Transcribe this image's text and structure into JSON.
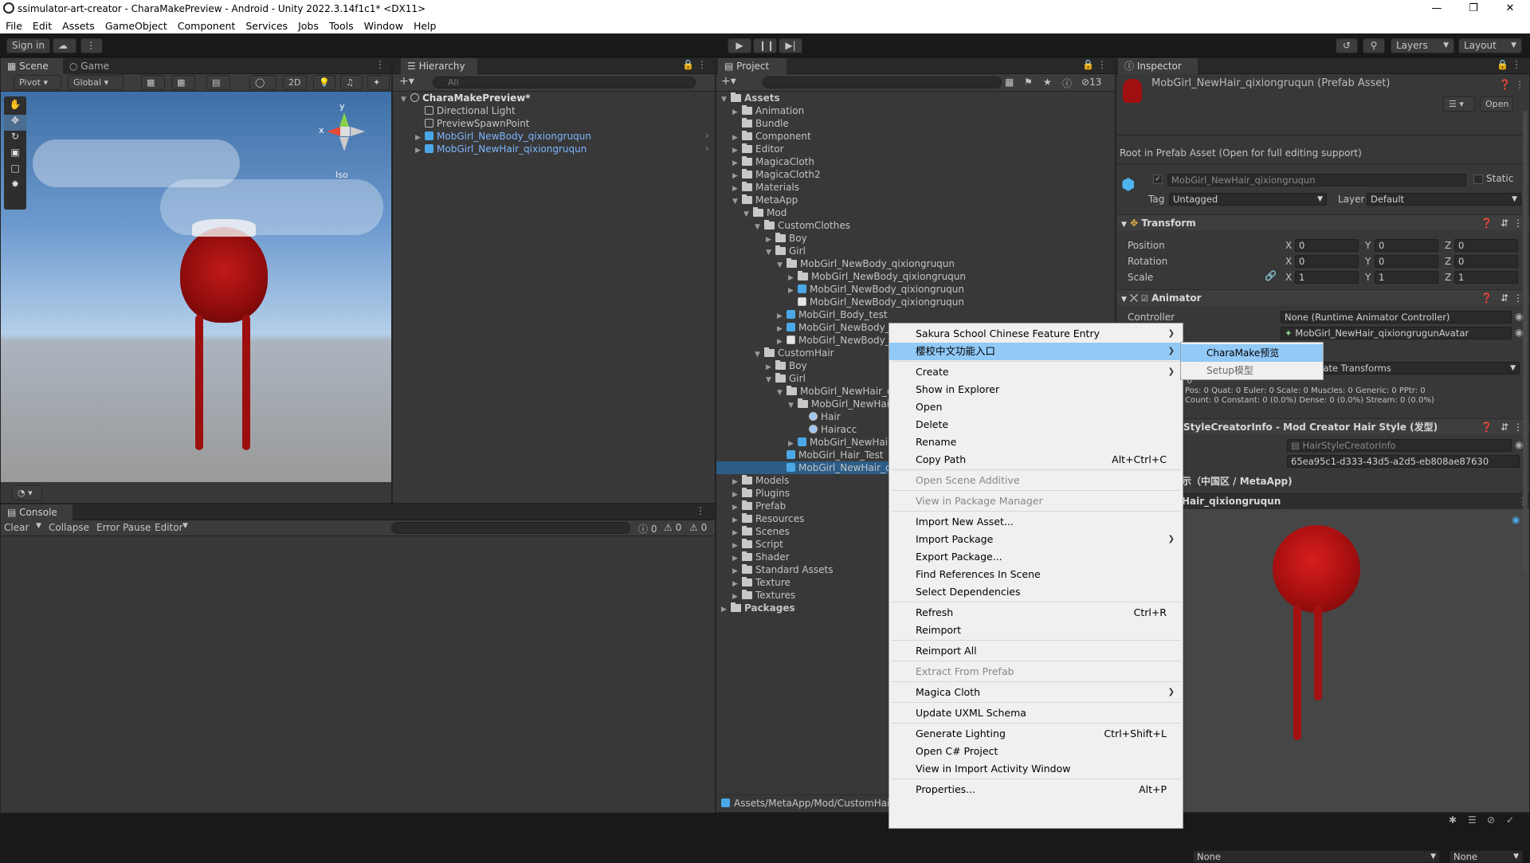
{
  "window": {
    "title": "ssimulator-art-creator - CharaMakePreview - Android - Unity 2022.3.14f1c1* <DX11>"
  },
  "menu": [
    "File",
    "Edit",
    "Assets",
    "GameObject",
    "Component",
    "Services",
    "Jobs",
    "Tools",
    "Window",
    "Help"
  ],
  "toolbar": {
    "sign_in": "Sign in",
    "layers": "Layers",
    "layout": "Layout"
  },
  "scene": {
    "tab_scene": "Scene",
    "tab_game": "Game",
    "pivot": "Pivot",
    "global": "Global",
    "mode_2d": "2D",
    "iso": "Iso",
    "axis_x": "x",
    "axis_y": "y"
  },
  "hierarchy": {
    "tab": "Hierarchy",
    "search": "All",
    "root": "CharaMakePreview*",
    "items": [
      "Directional Light",
      "PreviewSpawnPoint",
      "MobGirl_NewBody_qixiongruqun",
      "MobGirl_NewHair_qixiongruqun"
    ]
  },
  "project": {
    "tab": "Project",
    "count": "13",
    "path": "Assets/MetaApp/Mod/CustomHair/",
    "tree": [
      {
        "label": "Assets",
        "depth": 0,
        "type": "folder",
        "open": true
      },
      {
        "label": "Animation",
        "depth": 1,
        "type": "folder"
      },
      {
        "label": "Bundle",
        "depth": 1,
        "type": "folder",
        "noarrow": true
      },
      {
        "label": "Component",
        "depth": 1,
        "type": "folder"
      },
      {
        "label": "Editor",
        "depth": 1,
        "type": "folder"
      },
      {
        "label": "MagicaCloth",
        "depth": 1,
        "type": "folder"
      },
      {
        "label": "MagicaCloth2",
        "depth": 1,
        "type": "folder"
      },
      {
        "label": "Materials",
        "depth": 1,
        "type": "folder"
      },
      {
        "label": "MetaApp",
        "depth": 1,
        "type": "folder",
        "open": true
      },
      {
        "label": "Mod",
        "depth": 2,
        "type": "folder",
        "open": true
      },
      {
        "label": "CustomClothes",
        "depth": 3,
        "type": "folder",
        "open": true
      },
      {
        "label": "Boy",
        "depth": 4,
        "type": "folder"
      },
      {
        "label": "Girl",
        "depth": 4,
        "type": "folder",
        "open": true
      },
      {
        "label": "MobGirl_NewBody_qixiongruqun",
        "depth": 5,
        "type": "folder",
        "open": true
      },
      {
        "label": "MobGirl_NewBody_qixiongruqun",
        "depth": 6,
        "type": "folder"
      },
      {
        "label": "MobGirl_NewBody_qixiongruqun",
        "depth": 6,
        "type": "prefab"
      },
      {
        "label": "MobGirl_NewBody_qixiongruqun",
        "depth": 6,
        "type": "image",
        "noarrow": true
      },
      {
        "label": "MobGirl_Body_test",
        "depth": 5,
        "type": "cube"
      },
      {
        "label": "MobGirl_NewBody_qixiongruqun",
        "depth": 5,
        "type": "cube"
      },
      {
        "label": "MobGirl_NewBody_qixiongruqun",
        "depth": 5,
        "type": "image"
      },
      {
        "label": "CustomHair",
        "depth": 3,
        "type": "folder",
        "open": true
      },
      {
        "label": "Boy",
        "depth": 4,
        "type": "folder"
      },
      {
        "label": "Girl",
        "depth": 4,
        "type": "folder",
        "open": true
      },
      {
        "label": "MobGirl_NewHair_qixiongruqun",
        "depth": 5,
        "type": "folder",
        "open": true
      },
      {
        "label": "MobGirl_NewHair_qixiongruqun",
        "depth": 6,
        "type": "folder",
        "open": true
      },
      {
        "label": "Hair",
        "depth": 7,
        "type": "sphere",
        "noarrow": true
      },
      {
        "label": "Hairacc",
        "depth": 7,
        "type": "sphere",
        "noarrow": true
      },
      {
        "label": "MobGirl_NewHair_qixiongruqun",
        "depth": 6,
        "type": "prefab"
      },
      {
        "label": "MobGirl_Hair_Test",
        "depth": 5,
        "type": "cube",
        "noarrow": true
      },
      {
        "label": "MobGirl_NewHair_qixiongruqun",
        "depth": 5,
        "type": "cube",
        "noarrow": true,
        "selected": true
      },
      {
        "label": "Models",
        "depth": 1,
        "type": "folder"
      },
      {
        "label": "Plugins",
        "depth": 1,
        "type": "folder"
      },
      {
        "label": "Prefab",
        "depth": 1,
        "type": "folder"
      },
      {
        "label": "Resources",
        "depth": 1,
        "type": "folder"
      },
      {
        "label": "Scenes",
        "depth": 1,
        "type": "folder"
      },
      {
        "label": "Script",
        "depth": 1,
        "type": "folder"
      },
      {
        "label": "Shader",
        "depth": 1,
        "type": "folder"
      },
      {
        "label": "Standard Assets",
        "depth": 1,
        "type": "folder"
      },
      {
        "label": "Texture",
        "depth": 1,
        "type": "folder"
      },
      {
        "label": "Textures",
        "depth": 1,
        "type": "folder"
      },
      {
        "label": "Packages",
        "depth": 0,
        "type": "folder"
      }
    ]
  },
  "console": {
    "tab": "Console",
    "clear": "Clear",
    "collapse": "Collapse",
    "error_pause": "Error Pause",
    "editor": "Editor",
    "c1": "0",
    "c2": "0",
    "c3": "0"
  },
  "inspector": {
    "tab": "Inspector",
    "asset_title": "MobGirl_NewHair_qixiongruqun (Prefab Asset)",
    "open": "Open",
    "root_note": "Root in Prefab Asset (Open for full editing support)",
    "name": "MobGirl_NewHair_qixiongruqun",
    "static": "Static",
    "tag_label": "Tag",
    "tag": "Untagged",
    "layer_label": "Layer",
    "layer": "Default",
    "transform": "Transform",
    "position": "Position",
    "rotation": "Rotation",
    "scale": "Scale",
    "px": "0",
    "py": "0",
    "pz": "0",
    "rx": "0",
    "ry": "0",
    "rz": "0",
    "sx": "1",
    "sy": "1",
    "sz": "1",
    "X": "X",
    "Y": "Y",
    "Z": "Z",
    "animator": "Animator",
    "controller_label": "Controller",
    "controller": "None (Runtime Animator Controller)",
    "avatar": "MobGirl_NewHair_qixiongrugunAvatar",
    "culling": "Cull Update Transforms",
    "stats1": "Pos: 0 Quat: 0 Euler: 0 Scale: 0 Muscles: 0 Generic: 0 PPtr: 0",
    "stats2": "Count: 0 Constant: 0 (0.0%) Dense: 0 (0.0%) Stream: 0 (0.0%)",
    "stats0": ": 0",
    "hairstyle_head": "StyleCreatorInfo - Mod Creator Hair Style (发型)",
    "hairstyle_field": "HairStyleCreatorInfo",
    "guid": "65ea95c1-d333-43d5-a2d5-eb808ae87630",
    "display": "示（中国区 / MetaApp)",
    "preview_name": "Hair_qixiongruqun",
    "none1": "None",
    "none2": "None"
  },
  "context_menu": {
    "items": [
      {
        "label": "Sakura School Chinese Feature Entry",
        "sub": true
      },
      {
        "label": "樱校中文功能入口",
        "sub": true,
        "hl": true
      },
      {
        "sep": true
      },
      {
        "label": "Create",
        "sub": true
      },
      {
        "label": "Show in Explorer"
      },
      {
        "label": "Open"
      },
      {
        "label": "Delete"
      },
      {
        "label": "Rename"
      },
      {
        "label": "Copy Path",
        "sc": "Alt+Ctrl+C"
      },
      {
        "sep": true
      },
      {
        "label": "Open Scene Additive",
        "dis": true
      },
      {
        "sep": true
      },
      {
        "label": "View in Package Manager",
        "dis": true
      },
      {
        "sep": true
      },
      {
        "label": "Import New Asset..."
      },
      {
        "label": "Import Package",
        "sub": true
      },
      {
        "label": "Export Package..."
      },
      {
        "label": "Find References In Scene"
      },
      {
        "label": "Select Dependencies"
      },
      {
        "sep": true
      },
      {
        "label": "Refresh",
        "sc": "Ctrl+R"
      },
      {
        "label": "Reimport"
      },
      {
        "sep": true
      },
      {
        "label": "Reimport All"
      },
      {
        "sep": true
      },
      {
        "label": "Extract From Prefab",
        "dis": true
      },
      {
        "sep": true
      },
      {
        "label": "Magica Cloth",
        "sub": true
      },
      {
        "sep": true
      },
      {
        "label": "Update UXML Schema"
      },
      {
        "sep": true
      },
      {
        "label": "Generate Lighting",
        "sc": "Ctrl+Shift+L"
      },
      {
        "label": "Open C# Project"
      },
      {
        "label": "View in Import Activity Window"
      },
      {
        "sep": true
      },
      {
        "label": "Properties...",
        "sc": "Alt+P"
      }
    ]
  },
  "submenu": {
    "items": [
      "CharaMake预览",
      "Setup模型"
    ]
  },
  "colors": {
    "accent": "#2c5d87",
    "menu_highlight": "#91c9f7",
    "prefab_blue": "#7cb6ff"
  }
}
